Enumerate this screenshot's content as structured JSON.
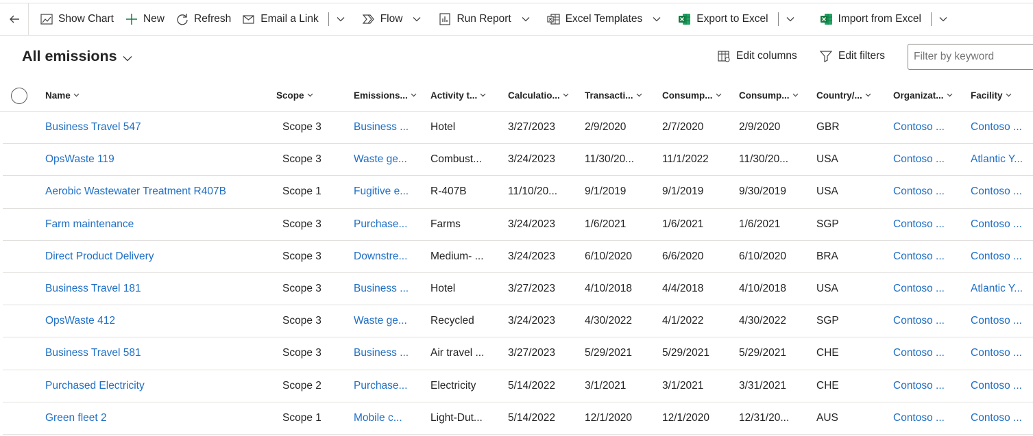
{
  "toolbar": {
    "show_chart": "Show Chart",
    "new": "New",
    "refresh": "Refresh",
    "email_link": "Email a Link",
    "flow": "Flow",
    "run_report": "Run Report",
    "excel_templates": "Excel Templates",
    "export_excel": "Export to Excel",
    "import_excel": "Import from Excel"
  },
  "view": {
    "title": "All emissions",
    "edit_columns": "Edit columns",
    "edit_filters": "Edit filters",
    "filter_placeholder": "Filter by keyword"
  },
  "columns": [
    "Name",
    "Scope",
    "Emissions...",
    "Activity t...",
    "Calculatio...",
    "Transacti...",
    "Consump...",
    "Consump...",
    "Country/...",
    "Organizat...",
    "Facility"
  ],
  "rows": [
    [
      "Business Travel 547",
      "Scope 3",
      "Business ...",
      "Hotel",
      "3/27/2023",
      "2/9/2020",
      "2/7/2020",
      "2/9/2020",
      "GBR",
      "Contoso ...",
      "Contoso ..."
    ],
    [
      "OpsWaste 119",
      "Scope 3",
      "Waste ge...",
      "Combust...",
      "3/24/2023",
      "11/30/20...",
      "11/1/2022",
      "11/30/20...",
      "USA",
      "Contoso ...",
      "Atlantic Y..."
    ],
    [
      "Aerobic Wastewater Treatment R407B",
      "Scope 1",
      "Fugitive e...",
      "R-407B",
      "11/10/20...",
      "9/1/2019",
      "9/1/2019",
      "9/30/2019",
      "USA",
      "Contoso ...",
      "Contoso ..."
    ],
    [
      "Farm maintenance",
      "Scope 3",
      "Purchase...",
      "Farms",
      "3/24/2023",
      "1/6/2021",
      "1/6/2021",
      "1/6/2021",
      "SGP",
      "Contoso ...",
      "Contoso ..."
    ],
    [
      "Direct Product Delivery",
      "Scope 3",
      "Downstre...",
      "Medium- ...",
      "3/24/2023",
      "6/10/2020",
      "6/6/2020",
      "6/10/2020",
      "BRA",
      "Contoso ...",
      "Contoso ..."
    ],
    [
      "Business Travel 181",
      "Scope 3",
      "Business ...",
      "Hotel",
      "3/27/2023",
      "4/10/2018",
      "4/4/2018",
      "4/10/2018",
      "USA",
      "Contoso ...",
      "Atlantic Y..."
    ],
    [
      "OpsWaste 412",
      "Scope 3",
      "Waste ge...",
      "Recycled",
      "3/24/2023",
      "4/30/2022",
      "4/1/2022",
      "4/30/2022",
      "SGP",
      "Contoso ...",
      "Contoso ..."
    ],
    [
      "Business Travel 581",
      "Scope 3",
      "Business ...",
      "Air travel ...",
      "3/27/2023",
      "5/29/2021",
      "5/29/2021",
      "5/29/2021",
      "CHE",
      "Contoso ...",
      "Contoso ..."
    ],
    [
      "Purchased Electricity",
      "Scope 2",
      "Purchase...",
      "Electricity",
      "5/14/2022",
      "3/1/2021",
      "3/1/2021",
      "3/31/2021",
      "CHE",
      "Contoso ...",
      "Contoso ..."
    ],
    [
      "Green fleet 2",
      "Scope 1",
      "Mobile c...",
      "Light-Dut...",
      "5/14/2022",
      "12/1/2020",
      "12/1/2020",
      "12/31/20...",
      "AUS",
      "Contoso ...",
      "Contoso ..."
    ]
  ],
  "colors": {
    "link": "#1f6fc5",
    "excel_green": "#107c41",
    "text": "#242424",
    "border": "#e1dfdd"
  }
}
